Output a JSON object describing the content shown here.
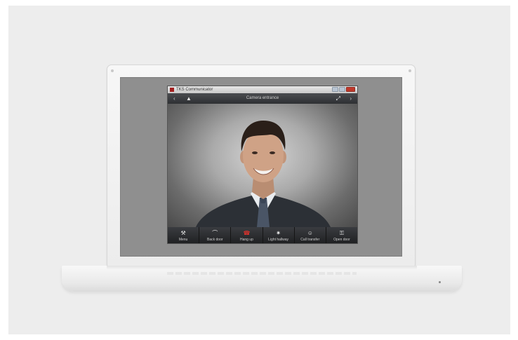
{
  "app": {
    "title": "TKS Communicator",
    "camera_name": "Camera entrance"
  },
  "toolbar": {
    "prev_icon": "chevron-left-icon",
    "next_icon": "chevron-right-icon",
    "camera_icon": "camera-icon",
    "fullscreen_icon": "expand-icon"
  },
  "actions": [
    {
      "label": "Menu",
      "icon": "wrench-icon",
      "glyph": "⚒",
      "color": "#e6e6e6"
    },
    {
      "label": "Back door",
      "icon": "door-arc-icon",
      "glyph": "⌒",
      "color": "#e6e6e6"
    },
    {
      "label": "Hang up",
      "icon": "hang-up-icon",
      "glyph": "☎",
      "color": "#e0322c"
    },
    {
      "label": "Light hallway",
      "icon": "light-icon",
      "glyph": "✷",
      "color": "#e6e6e6"
    },
    {
      "label": "Call transfer",
      "icon": "person-icon",
      "glyph": "☺",
      "color": "#e6e6e6"
    },
    {
      "label": "Open door",
      "icon": "key-icon",
      "glyph": "⚿",
      "color": "#e6e6e6"
    }
  ]
}
